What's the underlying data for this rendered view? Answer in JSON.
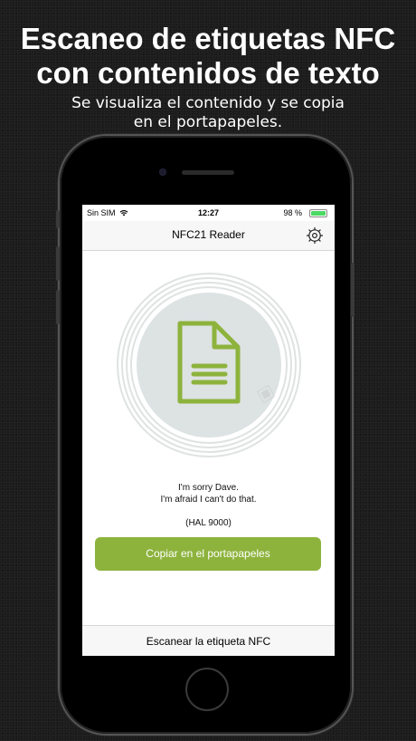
{
  "promo": {
    "headline_line1": "Escaneo de etiquetas NFC",
    "headline_line2": "con contenidos de texto",
    "subline_line1": "Se visualiza el contenido y se copia",
    "subline_line2": "en el portapapeles."
  },
  "statusbar": {
    "carrier": "Sin SIM",
    "time": "12:27",
    "battery_pct": "98 %",
    "battery_level": 0.98
  },
  "navbar": {
    "title": "NFC21 Reader",
    "settings_icon": "gear-icon"
  },
  "content": {
    "icon": "document-icon",
    "message_line1": "I'm sorry Dave.",
    "message_line2": "I'm afraid I can't do that.",
    "attribution": "(HAL 9000)",
    "copy_button_label": "Copiar en el portapapeles"
  },
  "bottombar": {
    "scan_label": "Escanear la etiqueta NFC"
  },
  "colors": {
    "accent": "#8db33d",
    "circle": "#dde2e2"
  }
}
